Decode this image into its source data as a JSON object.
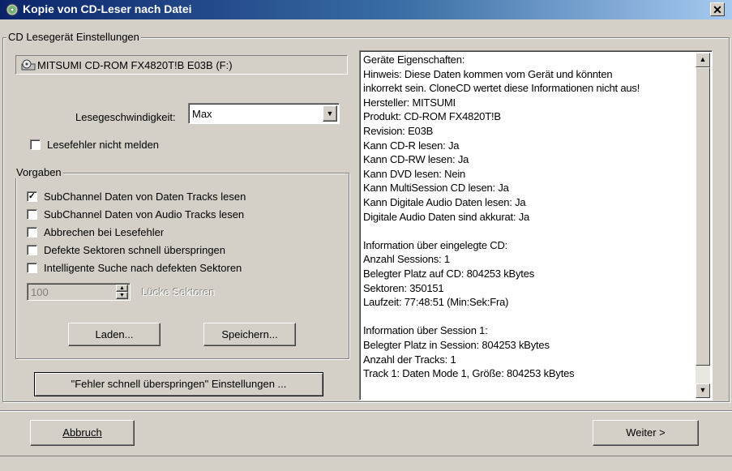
{
  "window": {
    "title": "Kopie von CD-Leser nach Datei",
    "close_glyph": "✕"
  },
  "reader_settings": {
    "legend": "CD Lesegerät Einstellungen",
    "drive": "MITSUMI CD-ROM FX4820T!B E03B (F:)",
    "speed_label": "Lesegeschwindigkeit:",
    "speed_value": "Max",
    "suppress_errors_label": "Lesefehler nicht melden",
    "suppress_errors_checked": false
  },
  "presets": {
    "legend": "Vorgaben",
    "options": [
      {
        "label": "SubChannel Daten von Daten Tracks lesen",
        "checked": true
      },
      {
        "label": "SubChannel Daten von Audio Tracks lesen",
        "checked": false
      },
      {
        "label": "Abbrechen bei Lesefehler",
        "checked": false
      },
      {
        "label": "Defekte Sektoren schnell überspringen",
        "checked": false
      },
      {
        "label": "Intelligente Suche nach defekten Sektoren",
        "checked": false
      }
    ],
    "gap_value": "100",
    "gap_label": "Lücke Sektoren",
    "load_label": "Laden...",
    "save_label": "Speichern..."
  },
  "skip_settings_button": "\"Fehler schnell überspringen\" Einstellungen ...",
  "info_lines": [
    "Geräte Eigenschaften:",
    "Hinweis: Diese Daten kommen vom Gerät und könnten",
    "inkorrekt sein. CloneCD wertet diese Informationen nicht aus!",
    "Hersteller: MITSUMI",
    "Produkt: CD-ROM FX4820T!B",
    "Revision: E03B",
    "Kann CD-R lesen: Ja",
    "Kann CD-RW lesen: Ja",
    "Kann DVD lesen: Nein",
    "Kann MultiSession CD lesen: Ja",
    "Kann Digitale Audio Daten lesen: Ja",
    "Digitale Audio Daten sind akkurat: Ja",
    "",
    "Information über eingelegte CD:",
    "Anzahl Sessions: 1",
    "Belegter Platz auf CD: 804253 kBytes",
    "Sektoren: 350151",
    "Laufzeit: 77:48:51 (Min:Sek:Fra)",
    "",
    "Information über Session 1:",
    "Belegter Platz in Session: 804253 kBytes",
    "Anzahl der Tracks: 1",
    "Track 1: Daten Mode 1, Größe: 804253 kBytes"
  ],
  "footer": {
    "cancel_label": "Abbruch",
    "next_label": "Weiter >"
  }
}
